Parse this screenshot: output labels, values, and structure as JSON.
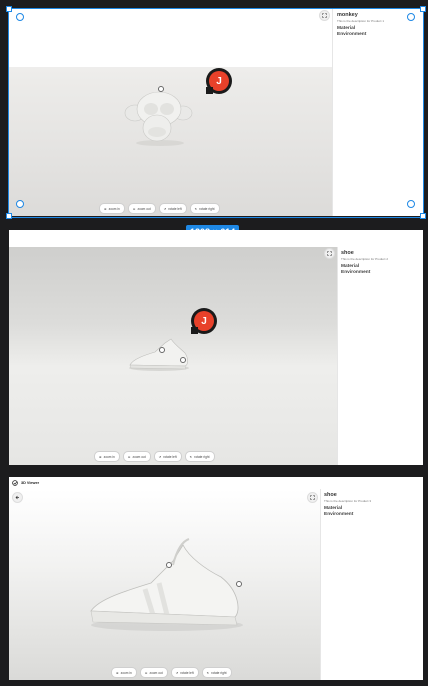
{
  "badge": "1208 × 614",
  "frame1": {
    "product": {
      "name": "monkey",
      "desc": "This is the description for Product 1",
      "material": "Material",
      "environment": "Environment"
    },
    "avatar": "J"
  },
  "frame2": {
    "product": {
      "name": "shoe",
      "desc": "This is the description for Product 2",
      "material": "Material",
      "environment": "Environment"
    },
    "avatar": "J"
  },
  "frame3": {
    "app_title": "3D Viewer",
    "product": {
      "name": "shoe",
      "desc": "This is the description for Product 3",
      "material": "Material",
      "environment": "Environment"
    }
  },
  "toolbar": {
    "zoom_in": "zoom in",
    "zoom_out": "zoom out",
    "rotate_left": "rotate left",
    "rotate_right": "rotate right"
  },
  "colors": {
    "accent": "#1e88e5",
    "avatar_red": "#e8412a"
  }
}
